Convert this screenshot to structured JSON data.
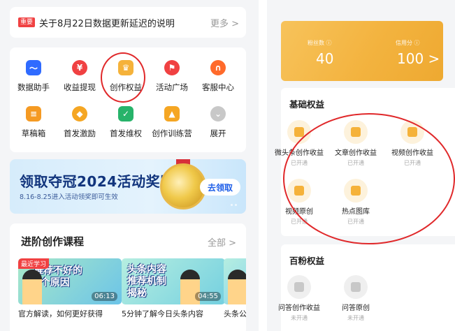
{
  "notice": {
    "tag": "重要",
    "text": "关于8月22日数据更新延迟的说明",
    "more": "更多 >"
  },
  "tools": [
    {
      "label": "数据助手",
      "icon": "chart-icon",
      "color": "#2f6bff",
      "glyph": "〜"
    },
    {
      "label": "收益提现",
      "icon": "yuan-icon",
      "color": "#f04142",
      "glyph": "¥"
    },
    {
      "label": "创作权益",
      "icon": "crown-icon",
      "color": "#f5b23a",
      "glyph": "♛"
    },
    {
      "label": "活动广场",
      "icon": "flag-icon",
      "color": "#f04142",
      "glyph": "⚑"
    },
    {
      "label": "客服中心",
      "icon": "headset-icon",
      "color": "#ff6a2b",
      "glyph": "∩"
    },
    {
      "label": "草稿箱",
      "icon": "draft-icon",
      "color": "#f59a23",
      "glyph": "≡"
    },
    {
      "label": "首发激励",
      "icon": "flame-icon",
      "color": "#f5a623",
      "glyph": "◆"
    },
    {
      "label": "首发维权",
      "icon": "shield-icon",
      "color": "#27b36a",
      "glyph": "✓"
    },
    {
      "label": "创作训练营",
      "icon": "graduation-cap-icon",
      "color": "#f5a623",
      "glyph": "▲"
    },
    {
      "label": "展开",
      "icon": "expand-icon",
      "color": "#c8c8c8",
      "glyph": "⌄"
    }
  ],
  "banner": {
    "title": "领取夺冠2024活动奖励",
    "subtitle": "8.16-8.25进入活动领奖即可生效",
    "button": "去领取"
  },
  "courses": {
    "title": "进阶创作课程",
    "all": "全部 >",
    "items": [
      {
        "thumb_text": "推荐不好的\n5个原因",
        "duration": "06:13",
        "badge": "最近学习",
        "title": "官方解读，如何更好获得"
      },
      {
        "thumb_text": "头条内容\n推荐机制\n揭秘",
        "duration": "04:55",
        "badge": "",
        "title": "5分钟了解今日头条内容"
      },
      {
        "thumb_text": "",
        "duration": "",
        "badge": "",
        "title": "头条公"
      }
    ]
  },
  "score": {
    "fans_label": "粉丝数 ⓘ",
    "fans_value": "40",
    "credit_label": "信用分 ⓘ",
    "credit_value": "100 >"
  },
  "basic": {
    "title": "基础权益",
    "items": [
      {
        "label": "微头条创作收益",
        "status": "已开通",
        "icon": "document-icon",
        "color": "#f5b23a"
      },
      {
        "label": "文章创作收益",
        "status": "已开通",
        "icon": "document-icon",
        "color": "#f5b23a"
      },
      {
        "label": "视频创作收益",
        "status": "已开通",
        "icon": "video-icon",
        "color": "#f5b23a"
      },
      {
        "label": "视频原创",
        "status": "已开通",
        "icon": "play-icon",
        "color": "#f5b23a"
      },
      {
        "label": "热点图库",
        "status": "已开通",
        "icon": "image-icon",
        "color": "#f5b23a"
      }
    ]
  },
  "hundred": {
    "title": "百粉权益",
    "items": [
      {
        "label": "问答创作收益",
        "status": "未开通",
        "icon": "qa-icon",
        "color": "#c8c8c8"
      },
      {
        "label": "问答原创",
        "status": "未开通",
        "icon": "question-icon",
        "color": "#c8c8c8"
      }
    ]
  }
}
